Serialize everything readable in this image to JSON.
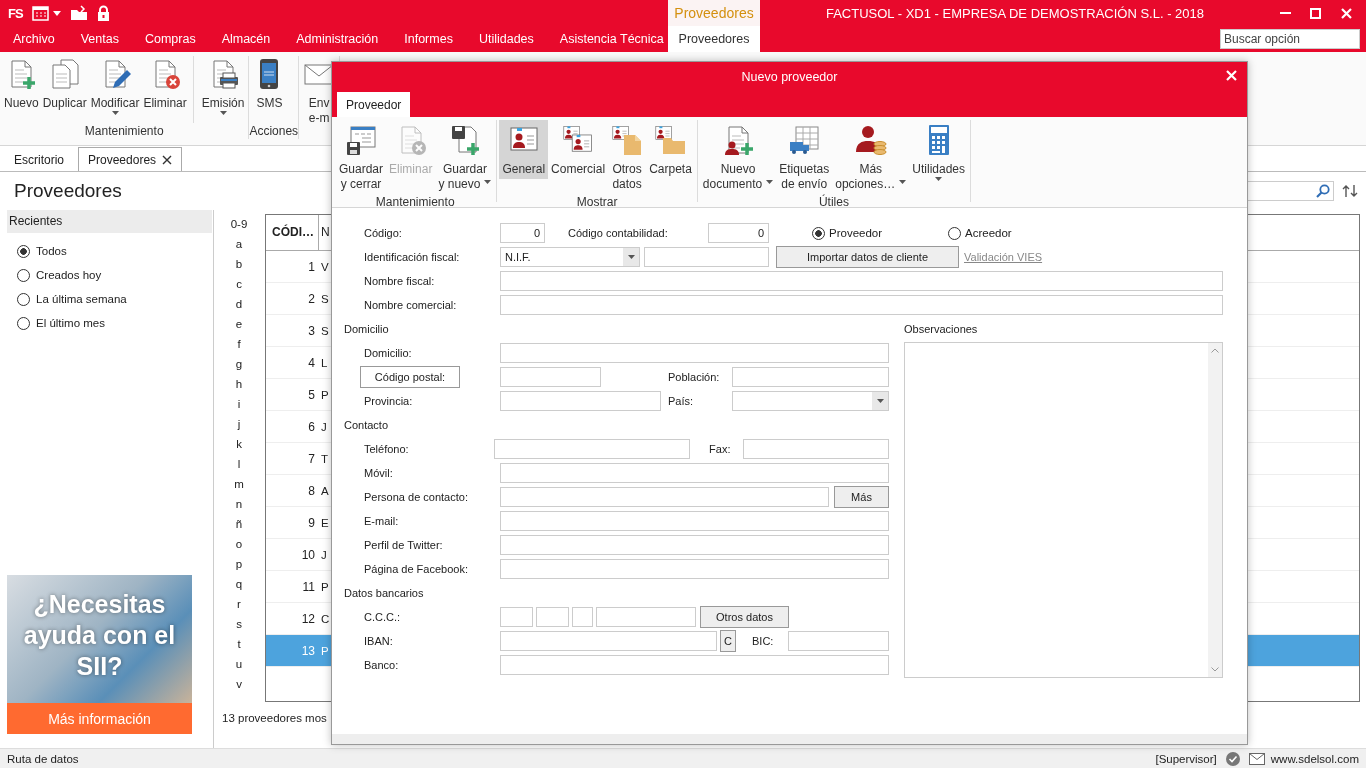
{
  "app": {
    "logo": "FS",
    "context_group": "Proveedores",
    "title": "FACTUSOL - XD1 - EMPRESA DE DEMOSTRACIÓN S.L. - 2018",
    "menu_tabs": [
      {
        "label": "Archivo",
        "selected": false,
        "contextual": false
      },
      {
        "label": "Ventas",
        "selected": false,
        "contextual": false
      },
      {
        "label": "Compras",
        "selected": false,
        "contextual": false
      },
      {
        "label": "Almacén",
        "selected": false,
        "contextual": false
      },
      {
        "label": "Administración",
        "selected": false,
        "contextual": false
      },
      {
        "label": "Informes",
        "selected": false,
        "contextual": false
      },
      {
        "label": "Utilidades",
        "selected": false,
        "contextual": false
      },
      {
        "label": "Asistencia Técnica",
        "selected": false,
        "contextual": false
      },
      {
        "label": "Proveedores",
        "selected": true,
        "contextual": true
      }
    ],
    "search": {
      "placeholder": "Buscar opción"
    },
    "ribbon": {
      "groups": [
        {
          "label": "Mantenimiento",
          "buttons": [
            {
              "kind": "new",
              "lines": [
                "Nuevo"
              ],
              "dropdown": false,
              "divider_before": false
            },
            {
              "kind": "duplicate",
              "lines": [
                "Duplicar"
              ],
              "dropdown": false,
              "divider_before": false
            },
            {
              "kind": "edit",
              "lines": [
                "Modificar"
              ],
              "dropdown": true,
              "divider_before": false
            },
            {
              "kind": "delete",
              "lines": [
                "Eliminar"
              ],
              "dropdown": false,
              "divider_before": false
            },
            {
              "kind": "print",
              "lines": [
                "Emisión"
              ],
              "dropdown": true,
              "divider_before": true
            }
          ]
        },
        {
          "label": "Acciones",
          "buttons": [
            {
              "kind": "sms",
              "lines": [
                "SMS"
              ],
              "dropdown": false,
              "divider_before": false
            }
          ]
        },
        {
          "buttons": [
            {
              "kind": "email",
              "lines": [
                "Env",
                "e-m"
              ],
              "dropdown": false,
              "divider_before": false
            }
          ]
        }
      ]
    },
    "doc_tabs": [
      {
        "label": "Escritorio",
        "selected": false,
        "closable": false
      },
      {
        "label": "Proveedores",
        "selected": true,
        "closable": true
      }
    ],
    "page_title": "Proveedores",
    "recent": {
      "title": "Recientes",
      "options": [
        {
          "label": "Todos",
          "selected": true
        },
        {
          "label": "Creados hoy",
          "selected": false
        },
        {
          "label": "La última semana",
          "selected": false
        },
        {
          "label": "El último mes",
          "selected": false
        }
      ]
    },
    "ad": {
      "headline": "¿Necesitas ayuda con el SII?",
      "button": "Más información"
    },
    "alphabet": [
      "0-9",
      "a",
      "b",
      "c",
      "d",
      "e",
      "f",
      "g",
      "h",
      "i",
      "j",
      "k",
      "l",
      "m",
      "n",
      "ñ",
      "o",
      "p",
      "q",
      "r",
      "s",
      "t",
      "u",
      "v"
    ],
    "table": {
      "columns": [
        "CÓDI…",
        "N"
      ],
      "rows": [
        {
          "code": "1",
          "name": "V",
          "selected": false
        },
        {
          "code": "2",
          "name": "S",
          "selected": false
        },
        {
          "code": "3",
          "name": "S",
          "selected": false
        },
        {
          "code": "4",
          "name": "L",
          "selected": false
        },
        {
          "code": "5",
          "name": "P",
          "selected": false
        },
        {
          "code": "6",
          "name": "J",
          "selected": false
        },
        {
          "code": "7",
          "name": "T",
          "selected": false
        },
        {
          "code": "8",
          "name": "A",
          "selected": false
        },
        {
          "code": "9",
          "name": "E",
          "selected": false
        },
        {
          "code": "10",
          "name": "J",
          "selected": false
        },
        {
          "code": "11",
          "name": "P",
          "selected": false
        },
        {
          "code": "12",
          "name": "C",
          "selected": false
        },
        {
          "code": "13",
          "name": "P",
          "selected": true
        }
      ],
      "footer": "13 proveedores mos"
    },
    "status_bar": {
      "left": "Ruta de datos",
      "user": "[Supervisor]",
      "url": "www.sdelsol.com"
    }
  },
  "dialog": {
    "title": "Nuevo proveedor",
    "tabs": [
      {
        "label": "Proveedor",
        "selected": true
      }
    ],
    "ribbon": {
      "groups": [
        {
          "label": "Mantenimiento",
          "buttons": [
            {
              "kind": "save-close",
              "lines": [
                "Guardar",
                "y cerrar"
              ],
              "dropdown": false,
              "disabled": false,
              "selected": false
            },
            {
              "kind": "delete",
              "lines": [
                "Eliminar"
              ],
              "dropdown": false,
              "disabled": true,
              "selected": false
            },
            {
              "kind": "save-new",
              "lines": [
                "Guardar",
                "y nuevo"
              ],
              "dropdown": true,
              "disabled": false,
              "selected": false
            }
          ]
        },
        {
          "label": "Mostrar",
          "buttons": [
            {
              "kind": "general",
              "lines": [
                "General"
              ],
              "dropdown": false,
              "disabled": false,
              "selected": true
            },
            {
              "kind": "commercial",
              "lines": [
                "Comercial"
              ],
              "dropdown": false,
              "disabled": false,
              "selected": false
            },
            {
              "kind": "other",
              "lines": [
                "Otros",
                "datos"
              ],
              "dropdown": false,
              "disabled": false,
              "selected": false
            },
            {
              "kind": "folder",
              "lines": [
                "Carpeta"
              ],
              "dropdown": false,
              "disabled": false,
              "selected": false
            }
          ]
        },
        {
          "label": "Útiles",
          "buttons": [
            {
              "kind": "new-doc",
              "lines": [
                "Nuevo",
                "documento"
              ],
              "dropdown": true,
              "disabled": false,
              "selected": false
            },
            {
              "kind": "labels",
              "lines": [
                "Etiquetas",
                "de envío"
              ],
              "dropdown": false,
              "disabled": false,
              "selected": false
            },
            {
              "kind": "more",
              "lines": [
                "Más",
                "opciones…"
              ],
              "dropdown": true,
              "disabled": false,
              "selected": false
            },
            {
              "kind": "tools",
              "lines": [
                "Utilidades"
              ],
              "dropdown": true,
              "disabled": false,
              "selected": false
            }
          ]
        }
      ]
    },
    "form": {
      "top_rows": [
        {
          "label": "Código:",
          "items": [
            {
              "kind": "number",
              "value": "0"
            },
            {
              "kind": "label",
              "text": "Código contabilidad:"
            },
            {
              "kind": "number",
              "value": "0"
            },
            {
              "kind": "radio",
              "text": "Proveedor",
              "selected": true
            },
            {
              "kind": "radio",
              "text": "Acreedor",
              "selected": false
            }
          ]
        },
        {
          "label": "Identificación fiscal:",
          "items": [
            {
              "kind": "select",
              "value": "N.I.F."
            },
            {
              "kind": "input"
            },
            {
              "kind": "button",
              "text": "Importar datos de cliente"
            },
            {
              "kind": "link",
              "text": "Validación VIES"
            }
          ]
        },
        {
          "label": "Nombre fiscal:",
          "items": [
            {
              "kind": "input"
            }
          ]
        },
        {
          "label": "Nombre comercial:",
          "items": [
            {
              "kind": "input"
            }
          ]
        }
      ],
      "sections": [
        {
          "title": "Domicilio",
          "rows": [
            {
              "label": "Domicilio:",
              "items": [
                {
                  "kind": "input"
                }
              ]
            },
            {
              "items": [
                {
                  "kind": "button",
                  "text": "Código postal:"
                },
                {
                  "kind": "input"
                },
                {
                  "kind": "label",
                  "text": "Población:"
                },
                {
                  "kind": "input"
                }
              ]
            },
            {
              "label": "Provincia:",
              "items": [
                {
                  "kind": "input"
                },
                {
                  "kind": "label",
                  "text": "País:"
                },
                {
                  "kind": "select"
                }
              ]
            }
          ]
        },
        {
          "title": "Contacto",
          "rows": [
            {
              "label": "Teléfono:",
              "items": [
                {
                  "kind": "input"
                },
                {
                  "kind": "label",
                  "text": "Fax:"
                },
                {
                  "kind": "input"
                }
              ]
            },
            {
              "label": "Móvil:",
              "items": [
                {
                  "kind": "input"
                }
              ]
            },
            {
              "label": "Persona de contacto:",
              "items": [
                {
                  "kind": "input"
                },
                {
                  "kind": "button",
                  "text": "Más"
                }
              ]
            },
            {
              "label": "E-mail:",
              "items": [
                {
                  "kind": "input"
                }
              ]
            },
            {
              "label": "Perfil de Twitter:",
              "items": [
                {
                  "kind": "input"
                }
              ]
            },
            {
              "label": "Página de Facebook:",
              "items": [
                {
                  "kind": "input"
                }
              ]
            }
          ]
        },
        {
          "title": "Datos bancarios",
          "rows": [
            {
              "label": "C.C.C.:",
              "items": [
                {
                  "kind": "input"
                },
                {
                  "kind": "input"
                },
                {
                  "kind": "input"
                },
                {
                  "kind": "input"
                },
                {
                  "kind": "button",
                  "text": "Otros datos"
                }
              ]
            },
            {
              "label": "IBAN:",
              "items": [
                {
                  "kind": "input"
                },
                {
                  "kind": "button",
                  "text": "C"
                },
                {
                  "kind": "label",
                  "text": "BIC:"
                },
                {
                  "kind": "input"
                }
              ]
            },
            {
              "label": "Banco:",
              "items": [
                {
                  "kind": "input"
                }
              ]
            }
          ]
        }
      ],
      "notes": {
        "label": "Observaciones"
      }
    }
  }
}
